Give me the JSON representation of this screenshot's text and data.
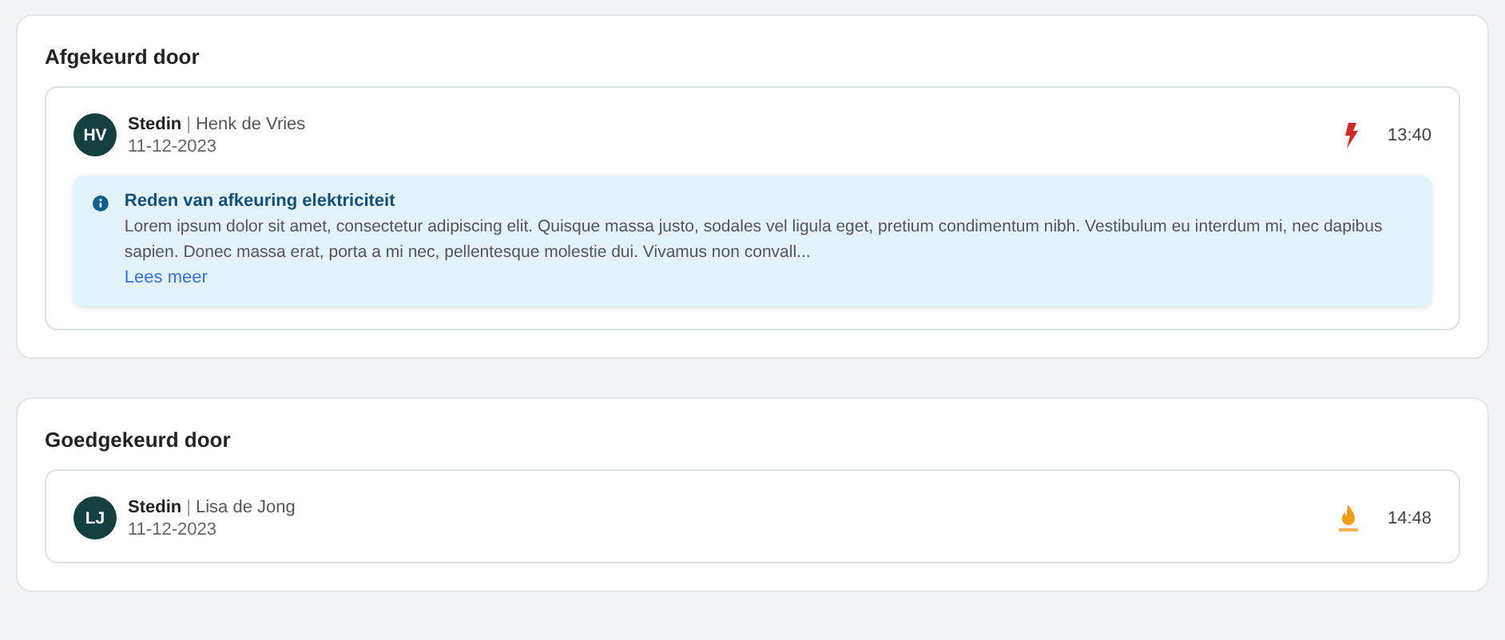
{
  "sections": [
    {
      "title": "Afgekeurd door",
      "entry": {
        "initials": "HV",
        "organisation": "Stedin",
        "separator": "|",
        "person": "Henk de Vries",
        "date": "11-12-2023",
        "kind": "electricity",
        "time": "13:40",
        "notice": {
          "title": "Reden van afkeuring elektriciteit",
          "body": "Lorem ipsum dolor sit amet, consectetur adipiscing elit. Quisque massa justo, sodales vel ligula eget, pretium condimentum nibh. Vestibulum eu interdum mi, nec dapibus sapien. Donec massa erat, porta a mi nec, pellentesque molestie dui. Vivamus non convall...",
          "link": "Lees meer"
        }
      }
    },
    {
      "title": "Goedgekeurd door",
      "entry": {
        "initials": "LJ",
        "organisation": "Stedin",
        "separator": "|",
        "person": "Lisa de Jong",
        "date": "11-12-2023",
        "kind": "gas",
        "time": "14:48"
      }
    }
  ]
}
